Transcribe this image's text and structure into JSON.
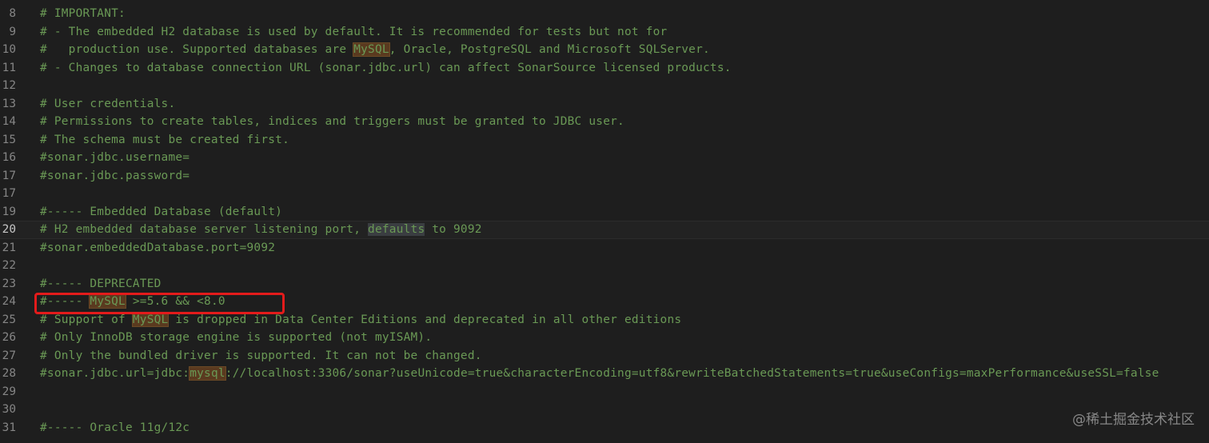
{
  "editor": {
    "language": "properties",
    "current_line": "20",
    "lines": [
      {
        "num": "8",
        "segs": [
          {
            "t": "# IMPORTANT:"
          }
        ]
      },
      {
        "num": "9",
        "segs": [
          {
            "t": "# - The embedded H2 database is used by default. It is recommended for tests but not for"
          }
        ]
      },
      {
        "num": "10",
        "segs": [
          {
            "t": "#   production use. Supported databases are "
          },
          {
            "t": "MySQL",
            "hl": "match"
          },
          {
            "t": ", Oracle, PostgreSQL and Microsoft SQLServer."
          }
        ]
      },
      {
        "num": "11",
        "segs": [
          {
            "t": "# - Changes to database connection URL (sonar.jdbc.url) can affect SonarSource licensed products."
          }
        ]
      },
      {
        "num": "12",
        "segs": []
      },
      {
        "num": "13",
        "segs": [
          {
            "t": "# User credentials."
          }
        ]
      },
      {
        "num": "14",
        "segs": [
          {
            "t": "# Permissions to create tables, indices and triggers must be granted to JDBC user."
          }
        ]
      },
      {
        "num": "15",
        "segs": [
          {
            "t": "# The schema must be created first."
          }
        ]
      },
      {
        "num": "16",
        "segs": [
          {
            "t": "#sonar.jdbc.username="
          }
        ]
      },
      {
        "num": "17",
        "segs": [
          {
            "t": "#sonar.jdbc.password="
          }
        ]
      },
      {
        "num": "17",
        "segs": []
      },
      {
        "num": "19",
        "segs": [
          {
            "t": "#----- Embedded Database (default)"
          }
        ]
      },
      {
        "num": "20",
        "segs": [
          {
            "t": "# H2 embedded database server listening port, "
          },
          {
            "t": "defaults",
            "hl": "selection"
          },
          {
            "t": " to 9092"
          }
        ]
      },
      {
        "num": "21",
        "segs": [
          {
            "t": "#sonar.embeddedDatabase.port=9092"
          }
        ]
      },
      {
        "num": "22",
        "segs": []
      },
      {
        "num": "23",
        "segs": [
          {
            "t": "#----- DEPRECATED"
          }
        ]
      },
      {
        "num": "24",
        "segs": [
          {
            "t": "#----- "
          },
          {
            "t": "MySQL",
            "hl": "match"
          },
          {
            "t": " >=5.6 && <8.0"
          }
        ]
      },
      {
        "num": "25",
        "segs": [
          {
            "t": "# Support of "
          },
          {
            "t": "MySQL",
            "hl": "match"
          },
          {
            "t": " is dropped in Data Center Editions and deprecated in all other editions"
          }
        ]
      },
      {
        "num": "26",
        "segs": [
          {
            "t": "# Only InnoDB storage engine is supported (not myISAM)."
          }
        ]
      },
      {
        "num": "27",
        "segs": [
          {
            "t": "# Only the bundled driver is supported. It can not be changed."
          }
        ]
      },
      {
        "num": "28",
        "segs": [
          {
            "t": "#sonar.jdbc.url=jdbc:"
          },
          {
            "t": "mysql",
            "hl": "match"
          },
          {
            "t": "://localhost:3306/sonar?useUnicode=true&characterEncoding=utf8&rewriteBatchedStatements=true&useConfigs=maxPerformance&useSSL=false"
          }
        ]
      },
      {
        "num": "29",
        "segs": []
      },
      {
        "num": "30",
        "segs": []
      },
      {
        "num": "31",
        "segs": [
          {
            "t": "#----- Oracle 11g/12c"
          }
        ]
      }
    ]
  },
  "annotation": {
    "label": "highlighted-line-24",
    "color": "#e31b1b"
  },
  "watermark": {
    "text": "@稀土掘金技术社区"
  },
  "colors": {
    "background": "#1e1e1e",
    "comment": "#6a9955",
    "line_number": "#858585",
    "find_match": "#5a3a1f",
    "selection": "#3a3d41"
  }
}
